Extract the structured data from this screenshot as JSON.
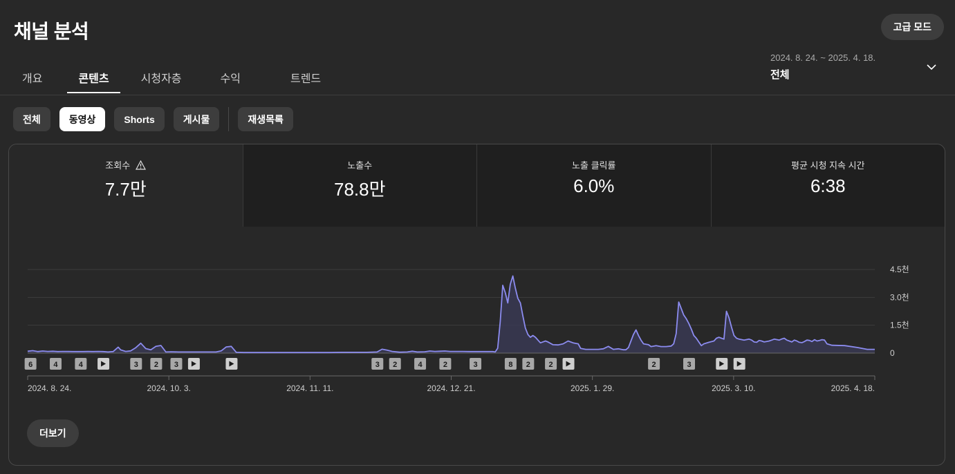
{
  "header": {
    "title": "채널 분석",
    "advanced_label": "고급 모드"
  },
  "tabs": [
    {
      "label": "개요",
      "active": false
    },
    {
      "label": "콘텐츠",
      "active": true
    },
    {
      "label": "시청자층",
      "active": false
    },
    {
      "label": "수익",
      "active": false
    },
    {
      "label": "트렌드",
      "active": false
    }
  ],
  "date_range": {
    "range": "2024. 8. 24. ~ 2025. 4. 18.",
    "value": "전체"
  },
  "chips": [
    {
      "label": "전체",
      "active": false
    },
    {
      "label": "동영상",
      "active": true
    },
    {
      "label": "Shorts",
      "active": false
    },
    {
      "label": "게시물",
      "active": false
    },
    {
      "label": "재생목록",
      "active": false
    }
  ],
  "metrics": [
    {
      "label": "조회수",
      "value": "7.7만",
      "warning": true,
      "active": true
    },
    {
      "label": "노출수",
      "value": "78.8만",
      "warning": false,
      "active": false
    },
    {
      "label": "노출 클릭률",
      "value": "6.0%",
      "warning": false,
      "active": false
    },
    {
      "label": "평균 시청 지속 시간",
      "value": "6:38",
      "warning": false,
      "active": false
    }
  ],
  "more_label": "더보기",
  "colors": {
    "line": "#8c8cf0",
    "fill": "#3a3a55",
    "grid": "#3c3c3c"
  },
  "chart_data": {
    "type": "area",
    "series_name": "",
    "x_start": "2024. 8. 24.",
    "x_end": "2025. 4. 18.",
    "x_tick_labels": [
      "2024. 8. 24.",
      "2024. 10. 3.",
      "2024. 11. 11.",
      "2024. 12. 21.",
      "2025. 1. 29.",
      "2025. 3. 10.",
      "2025. 4. 18."
    ],
    "y_tick_labels": [
      "4.5천",
      "3.0천",
      "1.5천",
      "0"
    ],
    "y_ticks": [
      4500,
      3000,
      1500,
      0
    ],
    "ylim": [
      0,
      4500
    ],
    "points": [
      [
        0,
        100
      ],
      [
        2,
        130
      ],
      [
        4,
        80
      ],
      [
        6,
        110
      ],
      [
        8,
        90
      ],
      [
        10,
        100
      ],
      [
        12,
        80
      ],
      [
        14,
        90
      ],
      [
        16,
        85
      ],
      [
        18,
        80
      ],
      [
        20,
        80
      ],
      [
        22,
        80
      ],
      [
        24,
        85
      ],
      [
        26,
        80
      ],
      [
        28,
        90
      ],
      [
        30,
        80
      ],
      [
        32,
        60
      ],
      [
        34,
        80
      ],
      [
        36,
        320
      ],
      [
        37,
        170
      ],
      [
        39,
        90
      ],
      [
        41,
        120
      ],
      [
        43,
        290
      ],
      [
        45,
        530
      ],
      [
        47,
        240
      ],
      [
        49,
        180
      ],
      [
        51,
        360
      ],
      [
        53,
        410
      ],
      [
        55,
        60
      ],
      [
        57,
        70
      ],
      [
        60,
        60
      ],
      [
        63,
        60
      ],
      [
        66,
        60
      ],
      [
        69,
        60
      ],
      [
        72,
        60
      ],
      [
        75,
        60
      ],
      [
        77,
        120
      ],
      [
        79,
        330
      ],
      [
        81,
        360
      ],
      [
        83,
        40
      ],
      [
        86,
        30
      ],
      [
        90,
        30
      ],
      [
        95,
        30
      ],
      [
        100,
        30
      ],
      [
        105,
        30
      ],
      [
        110,
        30
      ],
      [
        115,
        30
      ],
      [
        120,
        30
      ],
      [
        125,
        40
      ],
      [
        130,
        40
      ],
      [
        135,
        40
      ],
      [
        139,
        60
      ],
      [
        141,
        210
      ],
      [
        143,
        160
      ],
      [
        145,
        90
      ],
      [
        148,
        50
      ],
      [
        151,
        60
      ],
      [
        153,
        100
      ],
      [
        155,
        60
      ],
      [
        158,
        70
      ],
      [
        160,
        110
      ],
      [
        162,
        90
      ],
      [
        164,
        100
      ],
      [
        166,
        110
      ],
      [
        168,
        90
      ],
      [
        170,
        90
      ],
      [
        173,
        90
      ],
      [
        176,
        80
      ],
      [
        179,
        80
      ],
      [
        182,
        80
      ],
      [
        185,
        80
      ],
      [
        186,
        60
      ],
      [
        187,
        260
      ],
      [
        188,
        1700
      ],
      [
        189,
        3650
      ],
      [
        190,
        3250
      ],
      [
        191,
        2700
      ],
      [
        192,
        3700
      ],
      [
        193,
        4150
      ],
      [
        194,
        3500
      ],
      [
        195,
        2950
      ],
      [
        196,
        2700
      ],
      [
        197,
        2000
      ],
      [
        198,
        1350
      ],
      [
        199,
        1000
      ],
      [
        200,
        850
      ],
      [
        201,
        950
      ],
      [
        202,
        850
      ],
      [
        203,
        700
      ],
      [
        204,
        550
      ],
      [
        206,
        650
      ],
      [
        207,
        600
      ],
      [
        209,
        450
      ],
      [
        211,
        440
      ],
      [
        213,
        500
      ],
      [
        215,
        650
      ],
      [
        217,
        550
      ],
      [
        219,
        500
      ],
      [
        220,
        250
      ],
      [
        222,
        200
      ],
      [
        225,
        200
      ],
      [
        227,
        200
      ],
      [
        229,
        230
      ],
      [
        231,
        360
      ],
      [
        233,
        200
      ],
      [
        235,
        230
      ],
      [
        237,
        180
      ],
      [
        238,
        180
      ],
      [
        239,
        300
      ],
      [
        240,
        650
      ],
      [
        241,
        1000
      ],
      [
        242,
        1250
      ],
      [
        243,
        950
      ],
      [
        244,
        700
      ],
      [
        245,
        500
      ],
      [
        247,
        450
      ],
      [
        248,
        350
      ],
      [
        250,
        400
      ],
      [
        252,
        350
      ],
      [
        254,
        350
      ],
      [
        256,
        380
      ],
      [
        257,
        500
      ],
      [
        258,
        1050
      ],
      [
        259,
        2750
      ],
      [
        260,
        2400
      ],
      [
        261,
        2050
      ],
      [
        262,
        1850
      ],
      [
        263,
        1600
      ],
      [
        264,
        1300
      ],
      [
        265,
        950
      ],
      [
        266,
        800
      ],
      [
        267,
        600
      ],
      [
        268,
        400
      ],
      [
        269,
        500
      ],
      [
        271,
        580
      ],
      [
        273,
        650
      ],
      [
        274,
        800
      ],
      [
        275,
        850
      ],
      [
        276,
        800
      ],
      [
        277,
        750
      ],
      [
        278,
        2250
      ],
      [
        279,
        1900
      ],
      [
        280,
        1400
      ],
      [
        281,
        950
      ],
      [
        282,
        800
      ],
      [
        283,
        750
      ],
      [
        285,
        700
      ],
      [
        287,
        750
      ],
      [
        288,
        700
      ],
      [
        289,
        600
      ],
      [
        290,
        580
      ],
      [
        291,
        680
      ],
      [
        292,
        650
      ],
      [
        293,
        600
      ],
      [
        295,
        650
      ],
      [
        296,
        700
      ],
      [
        297,
        750
      ],
      [
        299,
        700
      ],
      [
        300,
        760
      ],
      [
        301,
        800
      ],
      [
        302,
        700
      ],
      [
        303,
        650
      ],
      [
        304,
        600
      ],
      [
        305,
        700
      ],
      [
        306,
        650
      ],
      [
        307,
        580
      ],
      [
        308,
        560
      ],
      [
        309,
        620
      ],
      [
        310,
        700
      ],
      [
        311,
        680
      ],
      [
        312,
        620
      ],
      [
        313,
        720
      ],
      [
        314,
        650
      ],
      [
        315,
        680
      ],
      [
        316,
        720
      ],
      [
        317,
        700
      ],
      [
        318,
        500
      ],
      [
        320,
        420
      ],
      [
        325,
        400
      ],
      [
        330,
        300
      ],
      [
        334,
        200
      ],
      [
        337,
        200
      ]
    ],
    "x_max": 337,
    "markers": [
      {
        "x": 1,
        "label": "6",
        "kind": "count"
      },
      {
        "x": 11,
        "label": "4",
        "kind": "count"
      },
      {
        "x": 21,
        "label": "4",
        "kind": "count"
      },
      {
        "x": 30,
        "label": "",
        "kind": "play"
      },
      {
        "x": 43,
        "label": "3",
        "kind": "count"
      },
      {
        "x": 51,
        "label": "2",
        "kind": "count"
      },
      {
        "x": 59,
        "label": "3",
        "kind": "count"
      },
      {
        "x": 66,
        "label": "",
        "kind": "play"
      },
      {
        "x": 81,
        "label": "",
        "kind": "play"
      },
      {
        "x": 139,
        "label": "3",
        "kind": "count"
      },
      {
        "x": 146,
        "label": "2",
        "kind": "count"
      },
      {
        "x": 156,
        "label": "4",
        "kind": "count"
      },
      {
        "x": 166,
        "label": "2",
        "kind": "count"
      },
      {
        "x": 178,
        "label": "3",
        "kind": "count"
      },
      {
        "x": 192,
        "label": "8",
        "kind": "count"
      },
      {
        "x": 199,
        "label": "2",
        "kind": "count"
      },
      {
        "x": 208,
        "label": "2",
        "kind": "count"
      },
      {
        "x": 215,
        "label": "",
        "kind": "play"
      },
      {
        "x": 249,
        "label": "2",
        "kind": "count"
      },
      {
        "x": 263,
        "label": "3",
        "kind": "count"
      },
      {
        "x": 276,
        "label": "",
        "kind": "play"
      },
      {
        "x": 283,
        "label": "",
        "kind": "play"
      }
    ]
  }
}
